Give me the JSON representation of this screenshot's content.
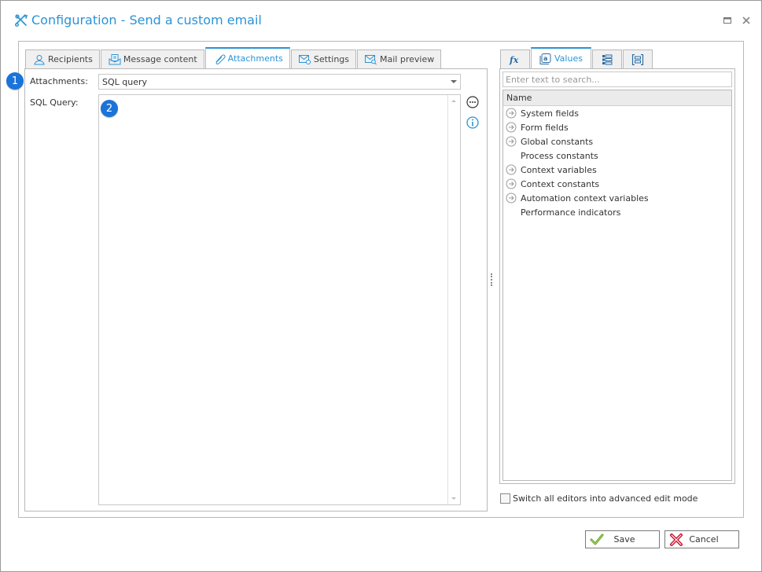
{
  "window": {
    "title": "Configuration - Send a custom email",
    "accent_color": "#2b93d6"
  },
  "left_tabs": [
    {
      "label": "Recipients",
      "icon": "person-icon",
      "active": false
    },
    {
      "label": "Message content",
      "icon": "message-icon",
      "active": false
    },
    {
      "label": "Attachments",
      "icon": "paperclip-icon",
      "active": true
    },
    {
      "label": "Settings",
      "icon": "mail-gear-icon",
      "active": false
    },
    {
      "label": "Mail preview",
      "icon": "mail-search-icon",
      "active": false
    }
  ],
  "form": {
    "attachments_label": "Attachments:",
    "attachments_value": "SQL query",
    "sql_query_label": "SQL Query:",
    "sql_query_value": ""
  },
  "badges": [
    "1",
    "2"
  ],
  "right_tabs": [
    {
      "label": "",
      "icon": "fx-icon",
      "active": false
    },
    {
      "label": "Values",
      "icon": "at-values-icon",
      "active": true
    },
    {
      "label": "",
      "icon": "list-icon",
      "active": false
    },
    {
      "label": "",
      "icon": "bracket-list-icon",
      "active": false
    }
  ],
  "values_panel": {
    "search_placeholder": "Enter text to search...",
    "column_header": "Name",
    "items": [
      {
        "label": "System fields",
        "expandable": true
      },
      {
        "label": "Form fields",
        "expandable": true
      },
      {
        "label": "Global constants",
        "expandable": true
      },
      {
        "label": "Process constants",
        "expandable": false
      },
      {
        "label": "Context variables",
        "expandable": true
      },
      {
        "label": "Context constants",
        "expandable": true
      },
      {
        "label": "Automation context variables",
        "expandable": true
      },
      {
        "label": "Performance indicators",
        "expandable": false
      }
    ]
  },
  "advanced_mode": {
    "label": "Switch all editors into advanced edit mode",
    "checked": false
  },
  "buttons": {
    "save": "Save",
    "cancel": "Cancel"
  }
}
